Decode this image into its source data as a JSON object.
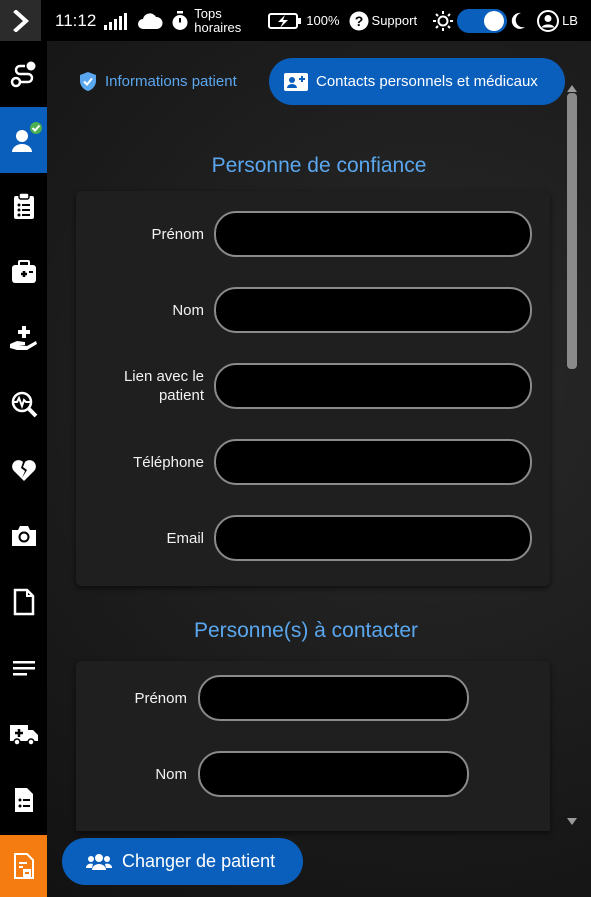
{
  "status_bar": {
    "time": "11:12",
    "tops_label_line1": "Tops",
    "tops_label_line2": "horaires",
    "battery_percent": "100%",
    "support_label": "Support",
    "user_initials": "LB",
    "dark_mode_toggle": "on"
  },
  "sidebar": {
    "items": [
      {
        "icon": "route-icon",
        "active": false
      },
      {
        "icon": "patient-check-icon",
        "active": true
      },
      {
        "icon": "clipboard-list-icon",
        "active": false
      },
      {
        "icon": "medical-kit-icon",
        "active": false
      },
      {
        "icon": "hand-medical-icon",
        "active": false
      },
      {
        "icon": "search-pulse-icon",
        "active": false
      },
      {
        "icon": "broken-heart-icon",
        "active": false
      },
      {
        "icon": "camera-icon",
        "active": false
      },
      {
        "icon": "document-icon",
        "active": false
      },
      {
        "icon": "lines-icon",
        "active": false
      },
      {
        "icon": "ambulance-icon",
        "active": false
      },
      {
        "icon": "file-list-icon",
        "active": false
      },
      {
        "icon": "file-transfer-icon",
        "active": false
      }
    ]
  },
  "tabs": {
    "info": "Informations patient",
    "contacts": "Contacts personnels et médicaux"
  },
  "trusted_person": {
    "title": "Personne de confiance",
    "fields": [
      {
        "label": "Prénom",
        "value": ""
      },
      {
        "label": "Nom",
        "value": ""
      },
      {
        "label": "Lien avec le patient",
        "value": ""
      },
      {
        "label": "Téléphone",
        "value": ""
      },
      {
        "label": "Email",
        "value": ""
      }
    ]
  },
  "contacts": {
    "title": "Personne(s) à contacter",
    "fields": [
      {
        "label": "Prénom",
        "value": ""
      },
      {
        "label": "Nom",
        "value": ""
      }
    ]
  },
  "footer": {
    "change_patient": "Changer de patient"
  },
  "colors": {
    "accent": "#0a5fbd",
    "title": "#5aa7ef",
    "orange": "#f57c10",
    "check": "#4caf50"
  }
}
